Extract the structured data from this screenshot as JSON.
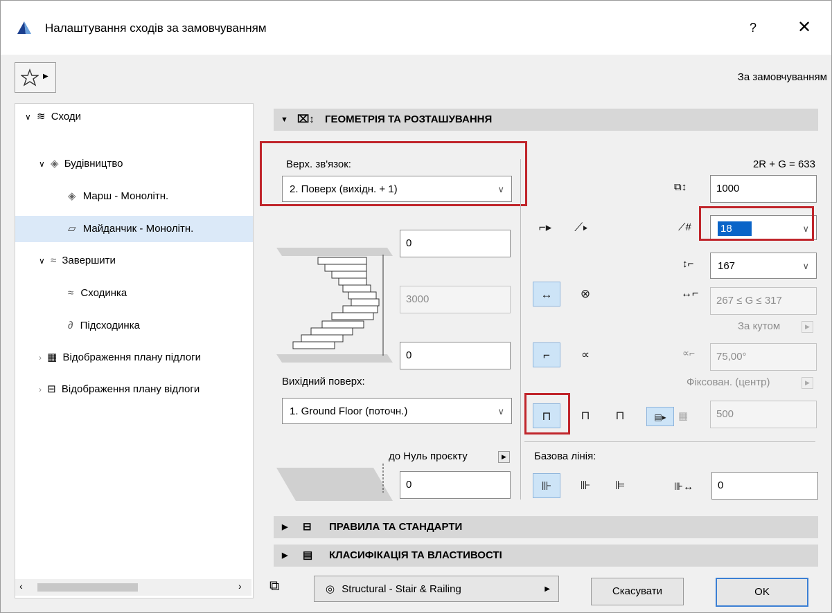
{
  "window": {
    "title": "Налаштування сходів за замовчуванням",
    "help": "?",
    "close": "✕"
  },
  "toolbar": {
    "favorites_icon": "star-icon",
    "default_label": "За замовчуванням"
  },
  "tree": {
    "items": [
      {
        "label": "Сходи"
      },
      {
        "label": "Будівництво"
      },
      {
        "label": "Марш - Монолітн."
      },
      {
        "label": "Майданчик - Монолітн."
      },
      {
        "label": "Завершити"
      },
      {
        "label": "Сходинка"
      },
      {
        "label": "Підсходинка"
      },
      {
        "label": "Відображення плану підлоги"
      },
      {
        "label": "Відображення плану відлоги"
      }
    ]
  },
  "sections": {
    "geometry": "ГЕОМЕТРІЯ ТА РОЗТАШУВАННЯ",
    "rules": "ПРАВИЛА ТА СТАНДАРТИ",
    "classification": "КЛАСИФІКАЦІЯ ТА ВЛАСТИВОСТІ"
  },
  "geometry": {
    "top_link_label": "Верх. зв'язок:",
    "top_link_value": "2. Поверх (вихідн. + 1)",
    "top_offset": "0",
    "height": "3000",
    "bottom_offset": "0",
    "home_floor_label": "Вихідний поверх:",
    "home_floor_value": "1. Ground Floor (поточн.)",
    "to_project_zero": "до Нуль проєкту",
    "project_zero_value": "0",
    "formula": "2R + G = 633",
    "width_value": "1000",
    "risers_value": "18",
    "riser_height_value": "167",
    "going_range": "267 ≤ G ≤ 317",
    "by_angle": "За кутом",
    "angle_value": "75,00°",
    "fixed_center": "Фіксован. (центр)",
    "walkline_value": "500",
    "baseline_label": "Базова лінія:",
    "baseline_offset": "0"
  },
  "footer": {
    "layer": "Structural - Stair & Railing",
    "cancel": "Скасувати",
    "ok": "OK"
  }
}
